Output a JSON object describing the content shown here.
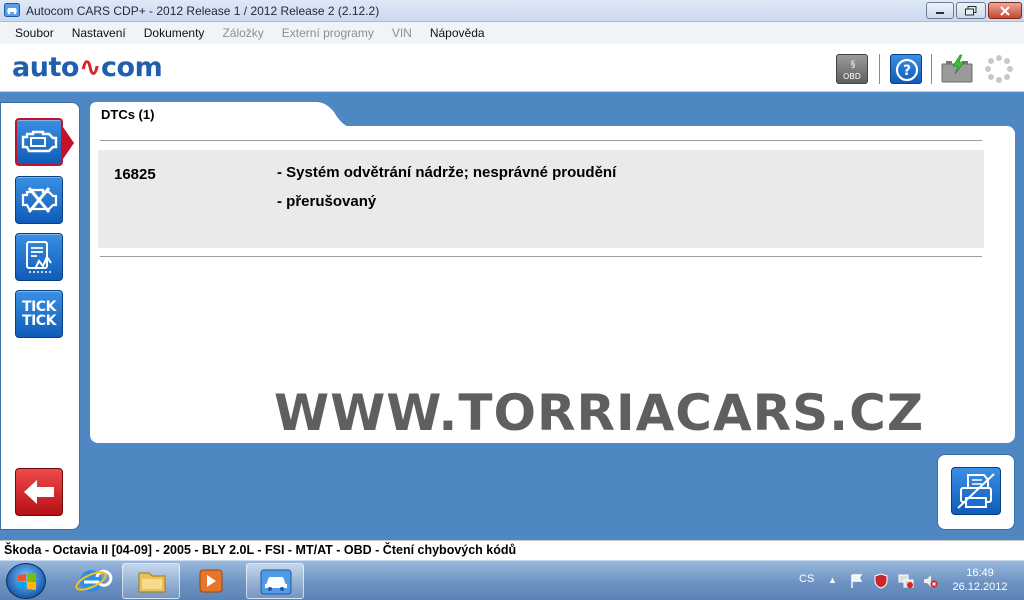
{
  "window": {
    "title": "Autocom CARS CDP+ - 2012 Release 1 / 2012 Release 2 (2.12.2)"
  },
  "menu": [
    {
      "label": "Soubor",
      "enabled": true
    },
    {
      "label": "Nastavení",
      "enabled": true
    },
    {
      "label": "Dokumenty",
      "enabled": true
    },
    {
      "label": "Záložky",
      "enabled": false
    },
    {
      "label": "Externí programy",
      "enabled": false
    },
    {
      "label": "VIN",
      "enabled": false
    },
    {
      "label": "Nápověda",
      "enabled": true
    }
  ],
  "header": {
    "logo_left": "auto",
    "logo_right": "com",
    "buttons": [
      "obd-book-icon",
      "help-icon",
      "battery-icon",
      "busy-spinner-icon"
    ]
  },
  "sidebar": {
    "items": [
      {
        "icon": "engine-icon",
        "active": true
      },
      {
        "icon": "erase-dtc-icon",
        "active": false
      },
      {
        "icon": "live-data-icon",
        "active": false
      },
      {
        "icon": "tick-tick-icon",
        "active": false,
        "text_top": "TICK",
        "text_bottom": "TICK"
      }
    ],
    "back_icon": "back-arrow-icon"
  },
  "main": {
    "tab_label": "DTCs (1)",
    "dtcs": [
      {
        "code": "16825",
        "description": "- Systém odvětrání nádrže; nesprávné proudění",
        "status": "- přerušovaný"
      }
    ],
    "watermark": "WWW.TORRIACARS.CZ",
    "print_icon": "print-report-icon"
  },
  "status_bar": {
    "text": "Škoda - Octavia II [04-09] - 2005 - BLY 2.0L - FSI - MT/AT - OBD - Čtení chybových kódů"
  },
  "taskbar": {
    "language": "CS",
    "time": "16:49",
    "date": "26.12.2012"
  },
  "colors": {
    "brand_blue": "#1f5fae",
    "brand_red": "#d7232b",
    "background": "#4e87c2",
    "button_blue": "#1a6fcf",
    "active_border": "#c4122a"
  }
}
